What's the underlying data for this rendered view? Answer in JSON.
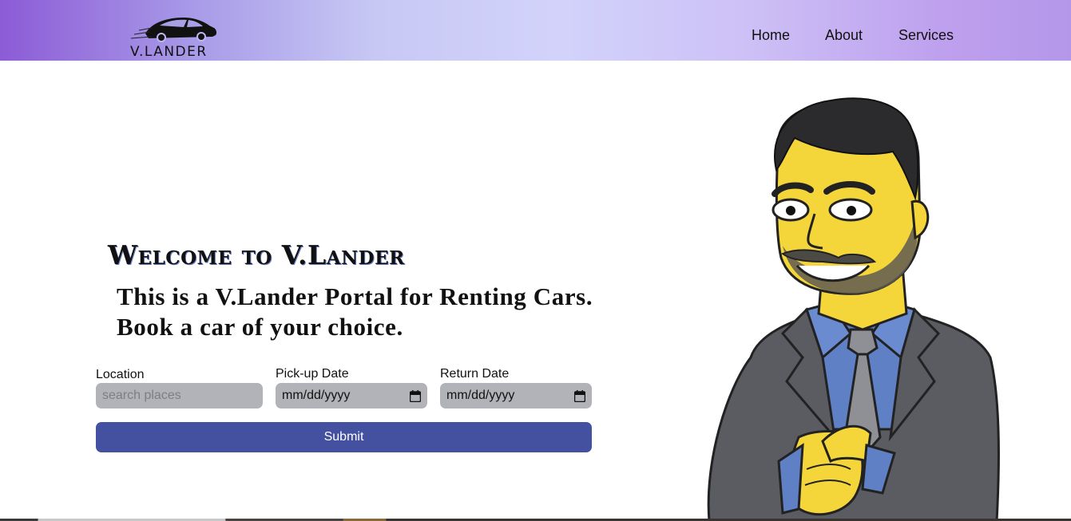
{
  "header": {
    "logo_text": "V.LANDER",
    "nav": [
      {
        "label": "Home"
      },
      {
        "label": "About"
      },
      {
        "label": "Services"
      }
    ]
  },
  "hero": {
    "title": "Welcome to V.Lander",
    "line1": "This is a V.Lander Portal for Renting Cars.",
    "line2": "Book a car of  your choice."
  },
  "form": {
    "location_label": "Location",
    "location_placeholder": "search places",
    "pickup_label": "Pick-up Date",
    "pickup_value": "mm/dd/yyyy",
    "return_label": "Return Date",
    "return_value": "mm/dd/yyyy",
    "submit_label": "Submit"
  },
  "colors": {
    "accent": "#4450a0",
    "input_bg": "#b2b3b8",
    "nav_gradient_start": "#8c5bd6",
    "nav_gradient_mid": "#d2d3fb"
  },
  "icons": {
    "logo": "car-logo-icon",
    "date": "calendar-icon"
  }
}
